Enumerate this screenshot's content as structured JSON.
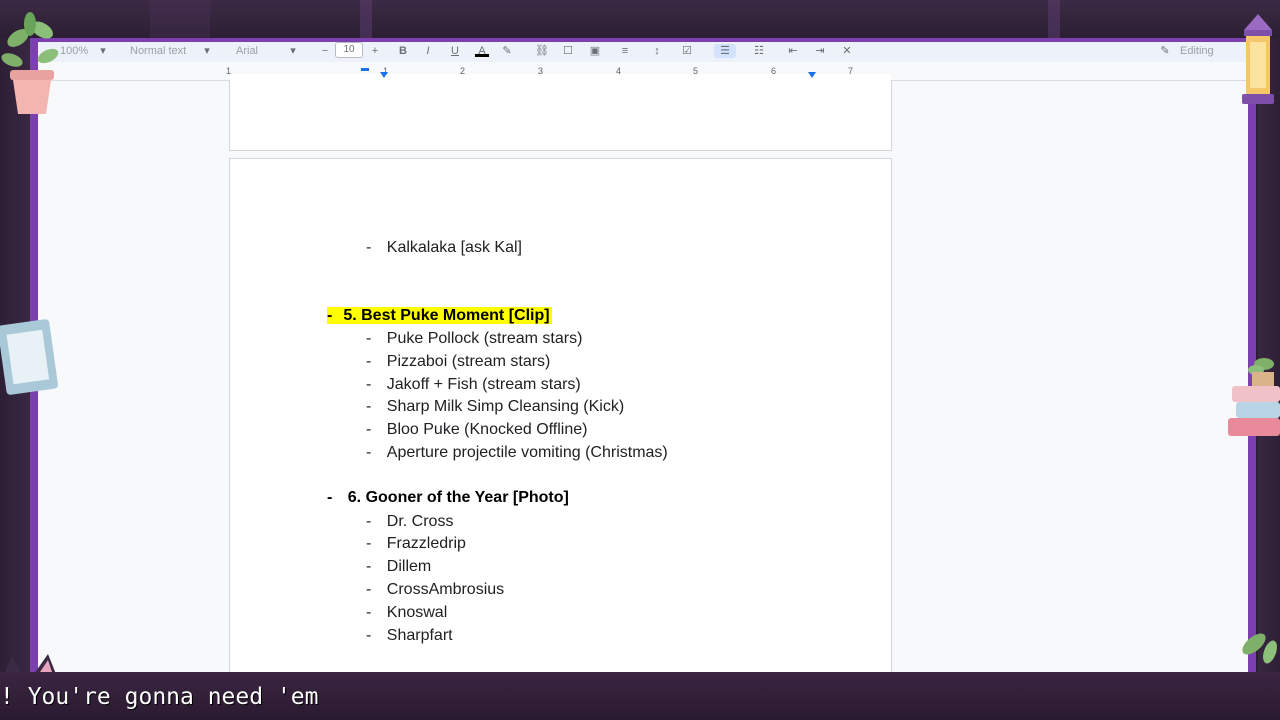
{
  "toolbar": {
    "zoom": "100%",
    "style": "Normal text",
    "font": "Arial",
    "font_size": "10",
    "mode": "Editing"
  },
  "ruler": {
    "numbers": [
      "1",
      "1",
      "2",
      "3",
      "4",
      "5",
      "6",
      "7"
    ]
  },
  "document": {
    "lines": [
      {
        "dash": "-",
        "text": "Kalkalaka [ask Kal]"
      },
      {
        "dash": "-",
        "text": "5. Best Puke Moment [Clip]"
      },
      {
        "dash": "-",
        "text": "Puke Pollock (stream stars)"
      },
      {
        "dash": "-",
        "text": "Pizzaboi (stream stars)"
      },
      {
        "dash": "-",
        "text": "Jakoff + Fish (stream stars)"
      },
      {
        "dash": "-",
        "text": "Sharp Milk Simp Cleansing (Kick)"
      },
      {
        "dash": "-",
        "text": "Bloo Puke (Knocked Offline)"
      },
      {
        "dash": "-",
        "text": "Aperture projectile vomiting (Christmas)"
      },
      {
        "dash": "-",
        "text": "6. Gooner of the Year [Photo]"
      },
      {
        "dash": "-",
        "text": "Dr. Cross"
      },
      {
        "dash": "-",
        "text": "Frazzledrip"
      },
      {
        "dash": "-",
        "text": "Dillem"
      },
      {
        "dash": "-",
        "text": "CrossAmbrosius"
      },
      {
        "dash": "-",
        "text": "Knoswal"
      },
      {
        "dash": "-",
        "text": "Sharpfart"
      }
    ]
  },
  "caption": {
    "text": "! You're gonna need 'em"
  },
  "colors": {
    "highlight": "#ffff00",
    "frame_purple": "#7b3fb0"
  }
}
